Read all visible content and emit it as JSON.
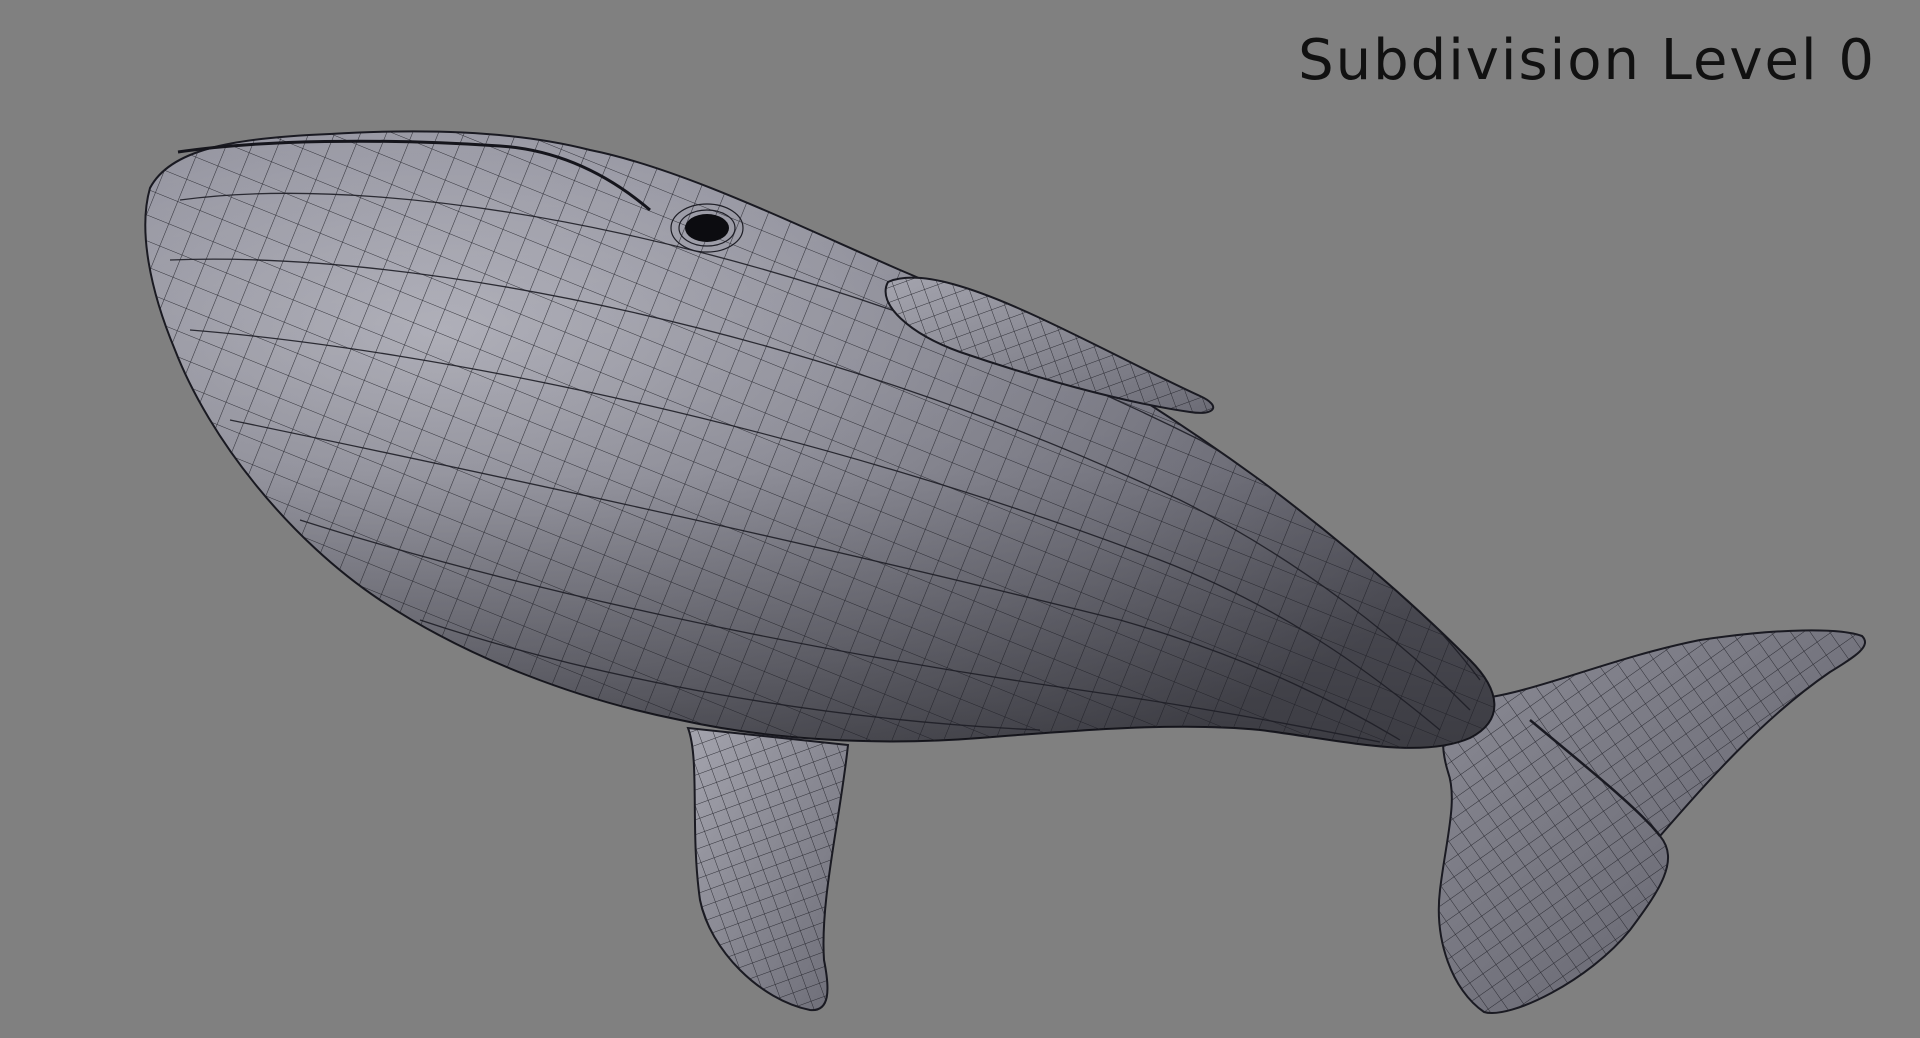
{
  "viewport": {
    "label": "Subdivision Level 0",
    "background_color": "#808080"
  },
  "model": {
    "name": "whale",
    "shading": "wireframe-on-shaded",
    "surface_color": "#8e8e98",
    "wire_color": "#1e1e26",
    "parts": [
      "body",
      "head",
      "eye",
      "dorsal-fin",
      "pectoral-fin",
      "tail-fluke"
    ]
  }
}
